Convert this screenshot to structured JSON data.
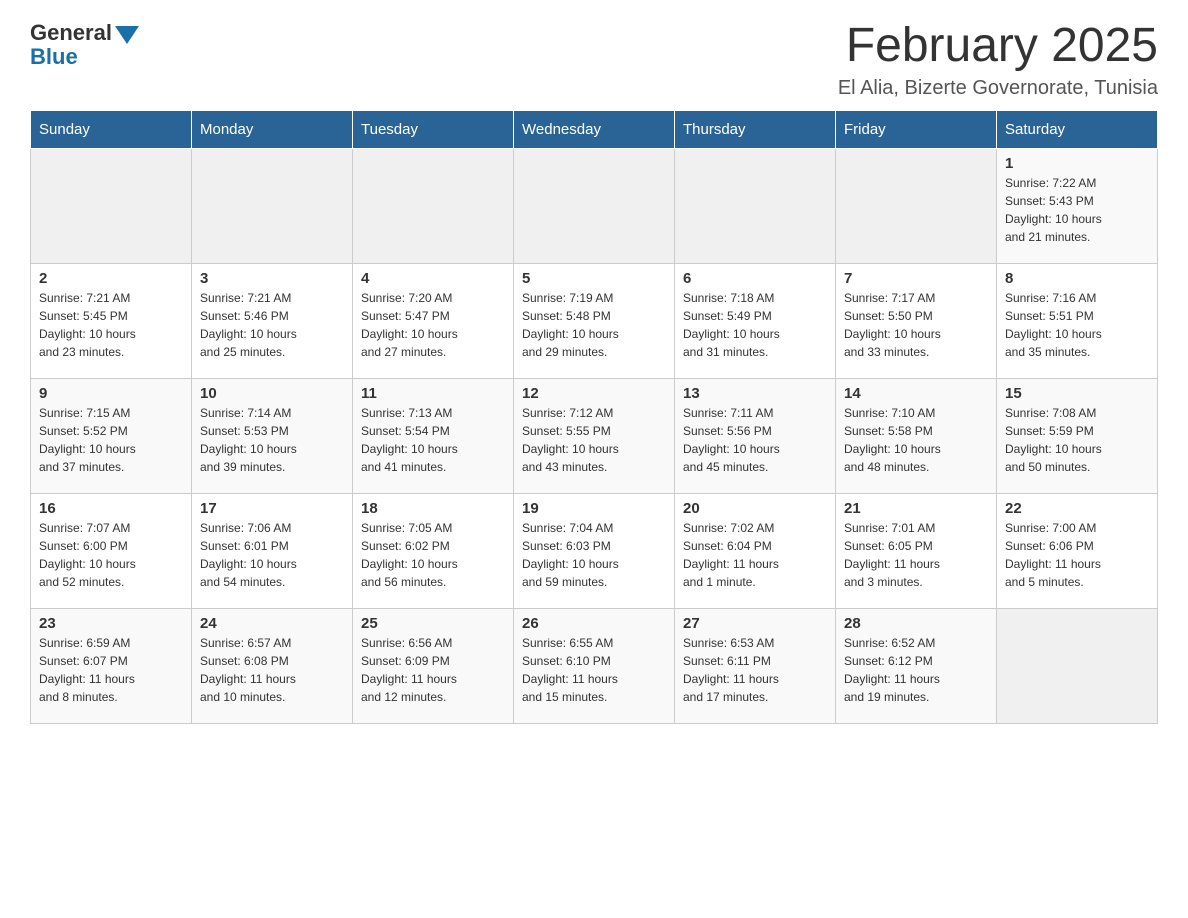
{
  "header": {
    "logo_general": "General",
    "logo_blue": "Blue",
    "title": "February 2025",
    "subtitle": "El Alia, Bizerte Governorate, Tunisia"
  },
  "weekdays": [
    "Sunday",
    "Monday",
    "Tuesday",
    "Wednesday",
    "Thursday",
    "Friday",
    "Saturday"
  ],
  "rows": [
    {
      "cells": [
        {
          "day": "",
          "info": ""
        },
        {
          "day": "",
          "info": ""
        },
        {
          "day": "",
          "info": ""
        },
        {
          "day": "",
          "info": ""
        },
        {
          "day": "",
          "info": ""
        },
        {
          "day": "",
          "info": ""
        },
        {
          "day": "1",
          "info": "Sunrise: 7:22 AM\nSunset: 5:43 PM\nDaylight: 10 hours\nand 21 minutes."
        }
      ]
    },
    {
      "cells": [
        {
          "day": "2",
          "info": "Sunrise: 7:21 AM\nSunset: 5:45 PM\nDaylight: 10 hours\nand 23 minutes."
        },
        {
          "day": "3",
          "info": "Sunrise: 7:21 AM\nSunset: 5:46 PM\nDaylight: 10 hours\nand 25 minutes."
        },
        {
          "day": "4",
          "info": "Sunrise: 7:20 AM\nSunset: 5:47 PM\nDaylight: 10 hours\nand 27 minutes."
        },
        {
          "day": "5",
          "info": "Sunrise: 7:19 AM\nSunset: 5:48 PM\nDaylight: 10 hours\nand 29 minutes."
        },
        {
          "day": "6",
          "info": "Sunrise: 7:18 AM\nSunset: 5:49 PM\nDaylight: 10 hours\nand 31 minutes."
        },
        {
          "day": "7",
          "info": "Sunrise: 7:17 AM\nSunset: 5:50 PM\nDaylight: 10 hours\nand 33 minutes."
        },
        {
          "day": "8",
          "info": "Sunrise: 7:16 AM\nSunset: 5:51 PM\nDaylight: 10 hours\nand 35 minutes."
        }
      ]
    },
    {
      "cells": [
        {
          "day": "9",
          "info": "Sunrise: 7:15 AM\nSunset: 5:52 PM\nDaylight: 10 hours\nand 37 minutes."
        },
        {
          "day": "10",
          "info": "Sunrise: 7:14 AM\nSunset: 5:53 PM\nDaylight: 10 hours\nand 39 minutes."
        },
        {
          "day": "11",
          "info": "Sunrise: 7:13 AM\nSunset: 5:54 PM\nDaylight: 10 hours\nand 41 minutes."
        },
        {
          "day": "12",
          "info": "Sunrise: 7:12 AM\nSunset: 5:55 PM\nDaylight: 10 hours\nand 43 minutes."
        },
        {
          "day": "13",
          "info": "Sunrise: 7:11 AM\nSunset: 5:56 PM\nDaylight: 10 hours\nand 45 minutes."
        },
        {
          "day": "14",
          "info": "Sunrise: 7:10 AM\nSunset: 5:58 PM\nDaylight: 10 hours\nand 48 minutes."
        },
        {
          "day": "15",
          "info": "Sunrise: 7:08 AM\nSunset: 5:59 PM\nDaylight: 10 hours\nand 50 minutes."
        }
      ]
    },
    {
      "cells": [
        {
          "day": "16",
          "info": "Sunrise: 7:07 AM\nSunset: 6:00 PM\nDaylight: 10 hours\nand 52 minutes."
        },
        {
          "day": "17",
          "info": "Sunrise: 7:06 AM\nSunset: 6:01 PM\nDaylight: 10 hours\nand 54 minutes."
        },
        {
          "day": "18",
          "info": "Sunrise: 7:05 AM\nSunset: 6:02 PM\nDaylight: 10 hours\nand 56 minutes."
        },
        {
          "day": "19",
          "info": "Sunrise: 7:04 AM\nSunset: 6:03 PM\nDaylight: 10 hours\nand 59 minutes."
        },
        {
          "day": "20",
          "info": "Sunrise: 7:02 AM\nSunset: 6:04 PM\nDaylight: 11 hours\nand 1 minute."
        },
        {
          "day": "21",
          "info": "Sunrise: 7:01 AM\nSunset: 6:05 PM\nDaylight: 11 hours\nand 3 minutes."
        },
        {
          "day": "22",
          "info": "Sunrise: 7:00 AM\nSunset: 6:06 PM\nDaylight: 11 hours\nand 5 minutes."
        }
      ]
    },
    {
      "cells": [
        {
          "day": "23",
          "info": "Sunrise: 6:59 AM\nSunset: 6:07 PM\nDaylight: 11 hours\nand 8 minutes."
        },
        {
          "day": "24",
          "info": "Sunrise: 6:57 AM\nSunset: 6:08 PM\nDaylight: 11 hours\nand 10 minutes."
        },
        {
          "day": "25",
          "info": "Sunrise: 6:56 AM\nSunset: 6:09 PM\nDaylight: 11 hours\nand 12 minutes."
        },
        {
          "day": "26",
          "info": "Sunrise: 6:55 AM\nSunset: 6:10 PM\nDaylight: 11 hours\nand 15 minutes."
        },
        {
          "day": "27",
          "info": "Sunrise: 6:53 AM\nSunset: 6:11 PM\nDaylight: 11 hours\nand 17 minutes."
        },
        {
          "day": "28",
          "info": "Sunrise: 6:52 AM\nSunset: 6:12 PM\nDaylight: 11 hours\nand 19 minutes."
        },
        {
          "day": "",
          "info": ""
        }
      ]
    }
  ]
}
